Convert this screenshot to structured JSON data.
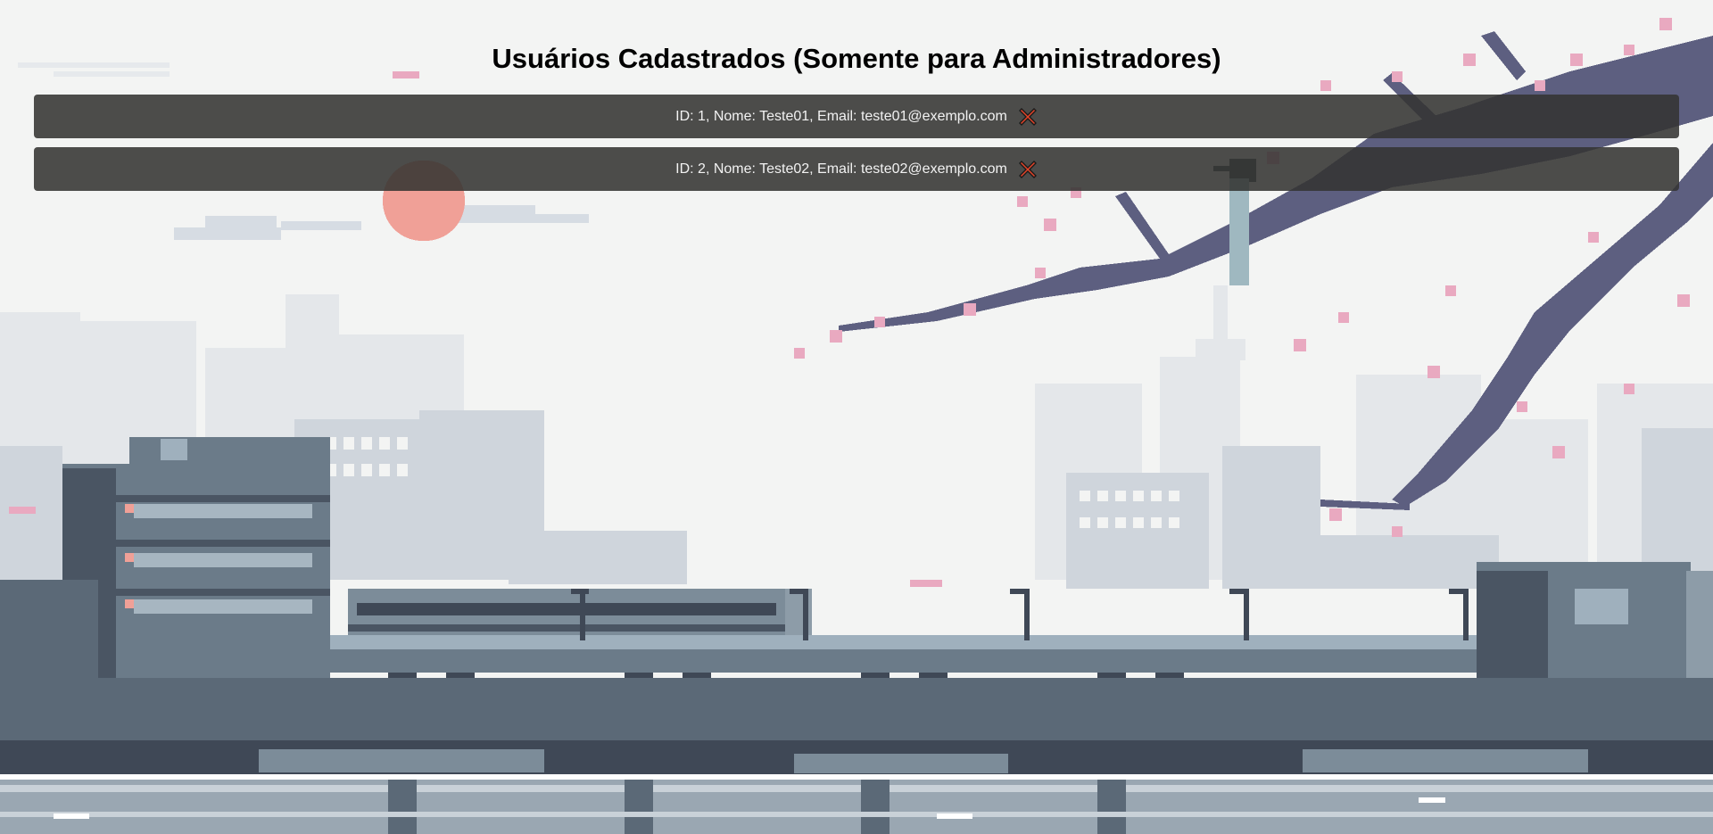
{
  "page": {
    "title": "Usuários Cadastrados (Somente para Administradores)"
  },
  "users": [
    {
      "text": "ID: 1, Nome: Teste01, Email: teste01@exemplo.com"
    },
    {
      "text": "ID: 2, Nome: Teste02, Email: teste02@exemplo.com"
    }
  ],
  "icons": {
    "delete": "close-x-icon"
  },
  "colors": {
    "row_background": "#343432",
    "row_text": "#f2f2f2",
    "delete_fill": "#e5452a",
    "delete_outline": "#1a1a1a",
    "sky": "#f3f4f3",
    "sun": "#f0a097"
  }
}
